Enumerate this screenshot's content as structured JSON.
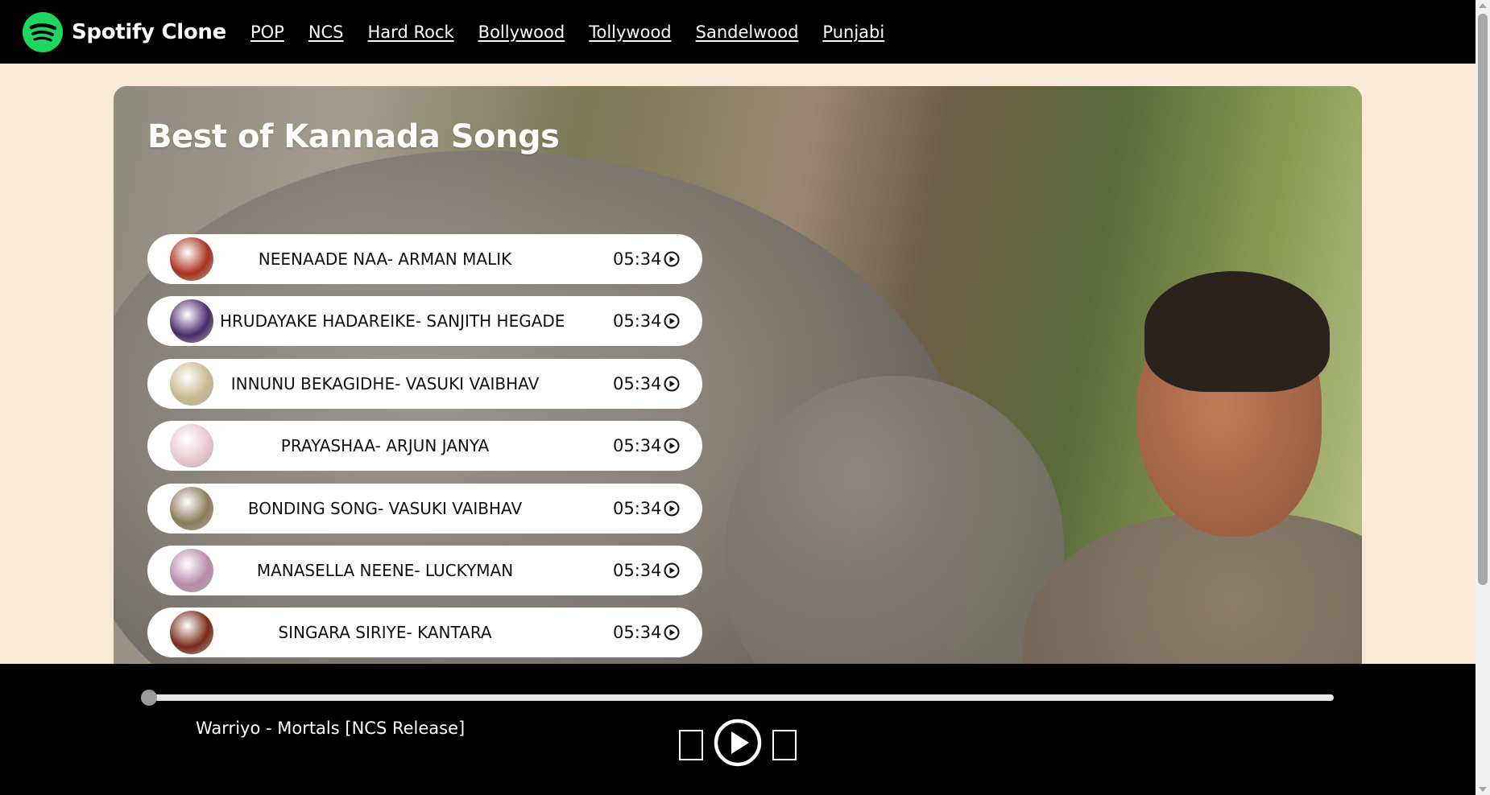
{
  "app": {
    "brand": "Spotify Clone",
    "logo_color": "#1ed760"
  },
  "nav": {
    "links": [
      "POP",
      "NCS",
      "Hard Rock",
      "Bollywood",
      "Tollywood",
      "Sandelwood",
      "Punjabi"
    ]
  },
  "hero": {
    "title": "Best of Kannada Songs"
  },
  "songs": [
    {
      "name": "NEENAADE NAA- ARMAN MALIK",
      "duration": "05:34",
      "cover_color": "#a8321e"
    },
    {
      "name": "HRUDAYAKE HADAREIKE- SANJITH HEGADE",
      "duration": "05:34",
      "cover_color": "#4a2a6a"
    },
    {
      "name": "INNUNU BEKAGIDHE- VASUKI VAIBHAV",
      "duration": "05:34",
      "cover_color": "#c9b98e"
    },
    {
      "name": "PRAYASHAA- ARJUN JANYA",
      "duration": "05:34",
      "cover_color": "#e8c8d0"
    },
    {
      "name": "BONDING SONG- VASUKI VAIBHAV",
      "duration": "05:34",
      "cover_color": "#8a7a5a"
    },
    {
      "name": "MANASELLA NEENE- LUCKYMAN",
      "duration": "05:34",
      "cover_color": "#b88aa8"
    },
    {
      "name": "SINGARA SIRIYE- KANTARA",
      "duration": "05:34",
      "cover_color": "#7a2a18"
    }
  ],
  "player": {
    "now_playing": "Warriyo - Mortals [NCS Release]",
    "progress": 0
  }
}
